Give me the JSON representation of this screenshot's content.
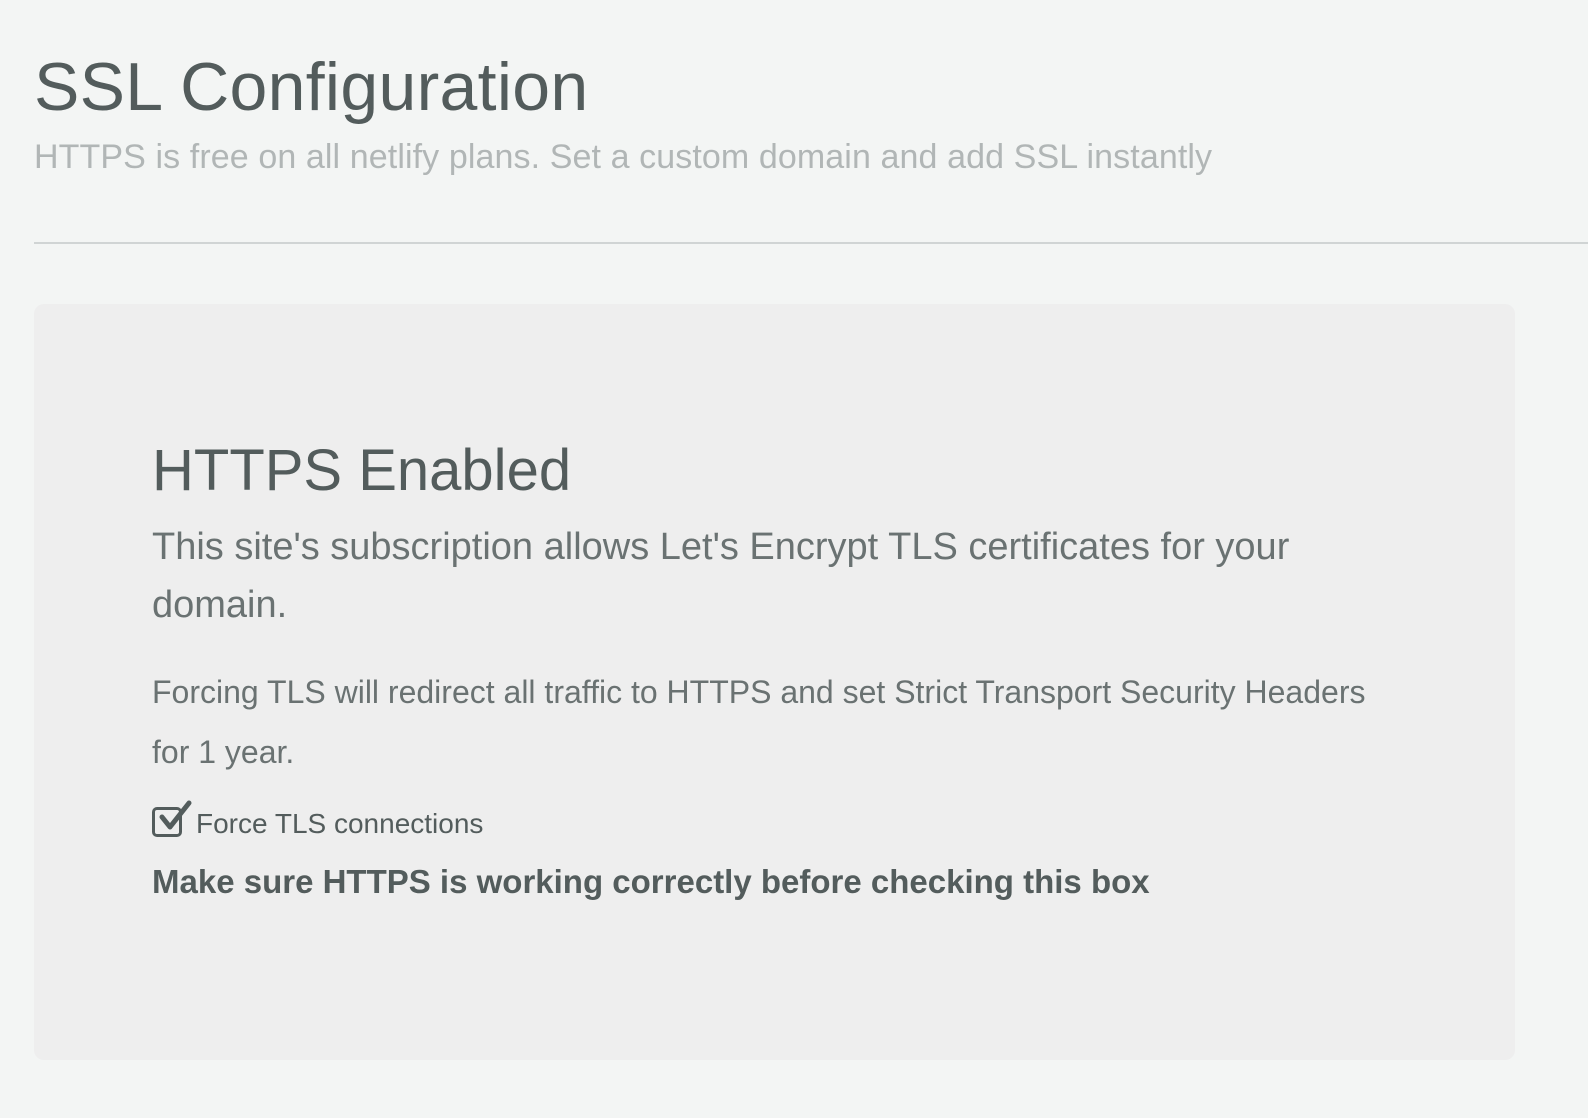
{
  "header": {
    "title": "SSL Configuration",
    "subtitle": "HTTPS is free on all netlify plans. Set a custom domain and add SSL instantly"
  },
  "card": {
    "title": "HTTPS Enabled",
    "lead": "This site's subscription allows Let's Encrypt TLS certificates for your domain.",
    "description": "Forcing TLS will redirect all traffic to HTTPS and set Strict Transport Security Headers for 1 year.",
    "checkbox": {
      "label": "Force TLS connections",
      "checked": true,
      "icon": "check-icon"
    },
    "warning": "Make sure HTTPS is working correctly before checking this box"
  },
  "colors": {
    "background": "#f3f5f4",
    "card_background": "#eeeeee",
    "text_primary": "#535c5c",
    "text_muted": "#b1b6b6",
    "divider": "#d0d4d4"
  }
}
